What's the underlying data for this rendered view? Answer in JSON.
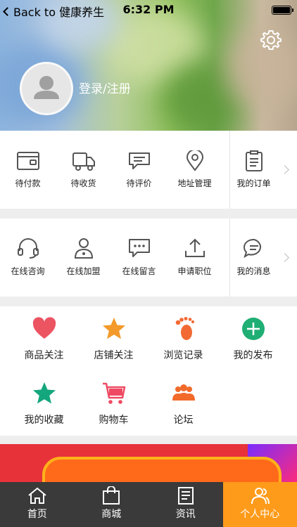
{
  "status_bar": {
    "back_label": "Back to 健康养生",
    "time": "6:32 PM"
  },
  "profile": {
    "login_label": "登录/注册"
  },
  "orders": [
    {
      "label": "待付款",
      "icon": "wallet-icon"
    },
    {
      "label": "待收货",
      "icon": "truck-icon"
    },
    {
      "label": "待评价",
      "icon": "comment-icon"
    },
    {
      "label": "地址管理",
      "icon": "location-pin-icon"
    },
    {
      "label": "我的订单",
      "icon": "clipboard-icon"
    }
  ],
  "services": [
    {
      "label": "在线咨询",
      "icon": "headset-icon"
    },
    {
      "label": "在线加盟",
      "icon": "person-icon"
    },
    {
      "label": "在线留言",
      "icon": "message-icon"
    },
    {
      "label": "申请职位",
      "icon": "upload-icon"
    },
    {
      "label": "我的消息",
      "icon": "chat-icon"
    }
  ],
  "features": [
    {
      "label": "商品关注",
      "icon": "heart-icon",
      "color": "#ec5462"
    },
    {
      "label": "店铺关注",
      "icon": "star-icon",
      "color": "#f39a2b"
    },
    {
      "label": "浏览记录",
      "icon": "footprint-icon",
      "color": "#f26a33"
    },
    {
      "label": "我的发布",
      "icon": "plus-circle-icon",
      "color": "#1fae74"
    },
    {
      "label": "我的收藏",
      "icon": "star-icon",
      "color": "#14a67c"
    },
    {
      "label": "购物车",
      "icon": "cart-icon",
      "color": "#ef4a63"
    },
    {
      "label": "论坛",
      "icon": "group-icon",
      "color": "#f26a2a"
    }
  ],
  "tabs": [
    {
      "label": "首页",
      "icon": "home-icon",
      "active": false
    },
    {
      "label": "商城",
      "icon": "shopping-bag-icon",
      "active": false
    },
    {
      "label": "资讯",
      "icon": "news-icon",
      "active": false
    },
    {
      "label": "个人中心",
      "icon": "user-group-icon",
      "active": true
    }
  ],
  "colors": {
    "accent": "#ff9b1a",
    "tabbar_bg": "#3a3a3a"
  }
}
